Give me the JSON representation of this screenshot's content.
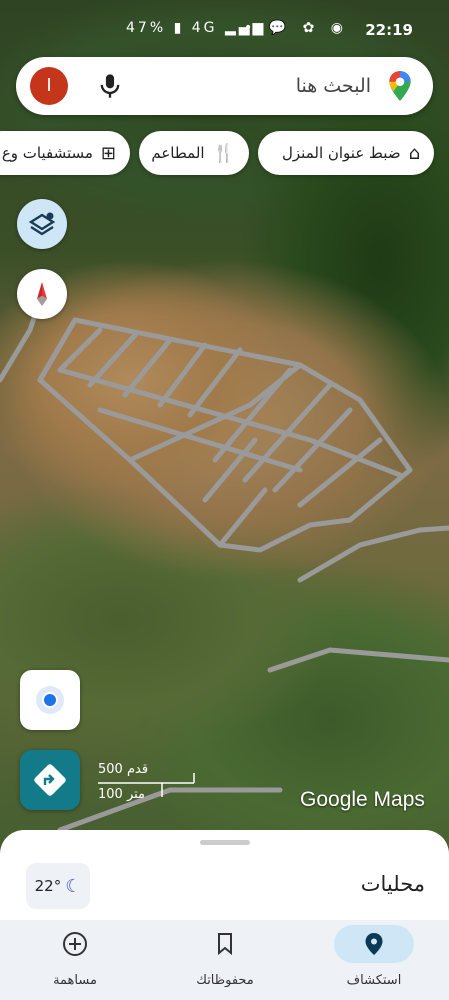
{
  "status_bar": {
    "time": "22:19",
    "battery": "47%",
    "network": "4G",
    "notification_icons": "• 💬 ✿ ◉"
  },
  "search": {
    "placeholder": "البحث هنا",
    "avatar_letter": "I"
  },
  "chips": [
    {
      "label": "ضبط عنوان المنزل",
      "icon": "home-icon"
    },
    {
      "label": "المطاعم",
      "icon": "restaurant-icon"
    },
    {
      "label": "مستشفيات وع",
      "icon": "hospital-icon"
    }
  ],
  "scale": {
    "feet": "500 قدم",
    "meters": "100 متر"
  },
  "brand": "Google Maps",
  "sheet": {
    "title": "محليات",
    "temperature": "22°"
  },
  "nav": [
    {
      "label": "استكشاف",
      "icon": "location-pin-icon",
      "active": true
    },
    {
      "label": "محفوظاتك",
      "icon": "bookmark-icon",
      "active": false
    },
    {
      "label": "مساهمة",
      "icon": "add-circle-icon",
      "active": false
    }
  ],
  "colors": {
    "accent": "#1a73e8",
    "avatar": "#c4351a",
    "nav_active": "#cfe6f6",
    "directions_button": "#137a8a"
  }
}
